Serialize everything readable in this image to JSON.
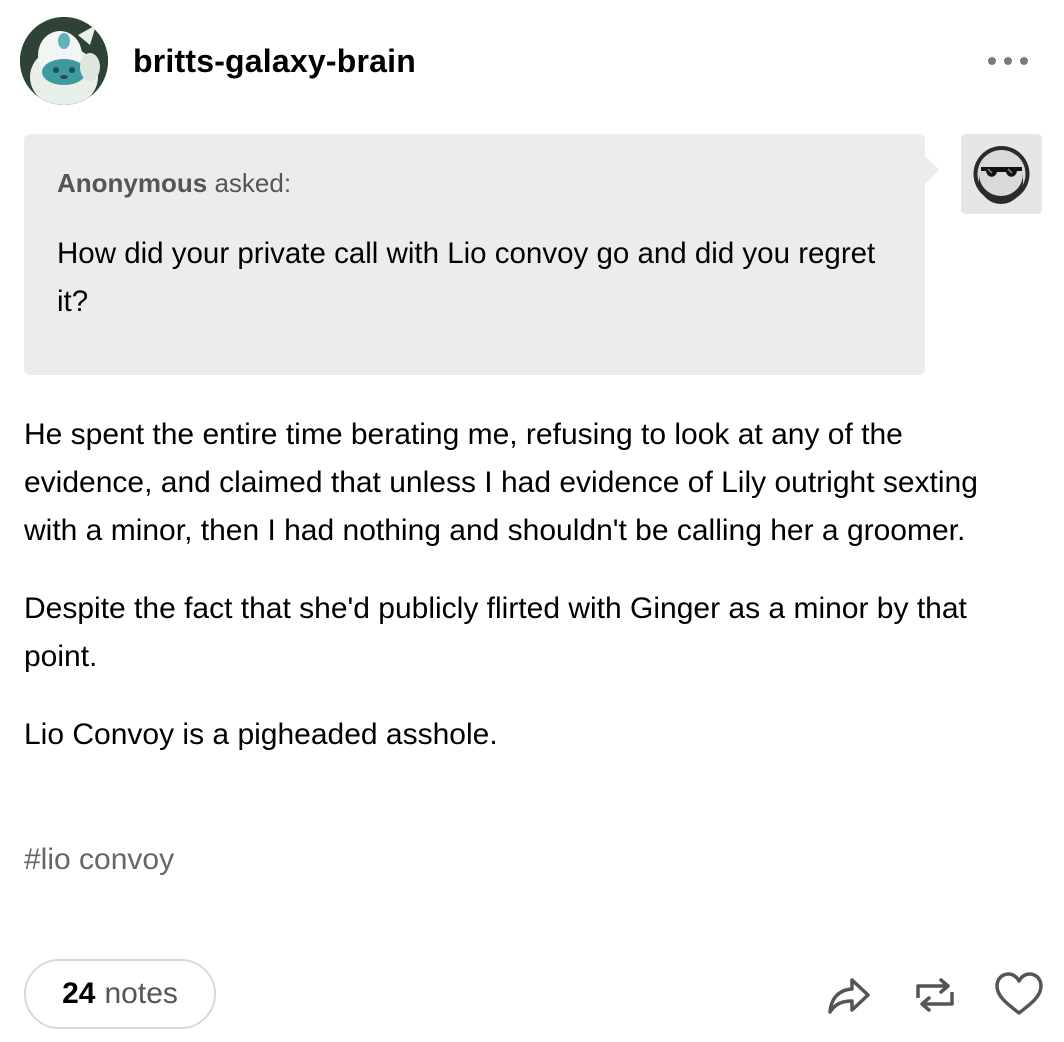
{
  "post": {
    "blog_name": "britts-galaxy-brain",
    "ask": {
      "asker": "Anonymous",
      "asked_label": "asked:",
      "question": "How did your private call with Lio convoy go and did you regret it?"
    },
    "paragraphs": [
      "He spent the entire time berating me, refusing to look at any of the evidence, and claimed that unless I had evidence of Lily outright sexting with a minor, then I had nothing and shouldn't be calling her a groomer.",
      "Despite the fact that she'd publicly flirted with Ginger as a minor by that point.",
      "Lio Convoy is a pigheaded asshole."
    ],
    "tags": [
      "#lio convoy"
    ],
    "notes": {
      "count": "24",
      "label": "notes"
    }
  },
  "icons": {
    "more": "more-horizontal-icon",
    "share": "share-icon",
    "reblog": "reblog-icon",
    "like": "heart-icon"
  },
  "colors": {
    "bubble_bg": "#ececec",
    "muted_text": "#555555",
    "tag_text": "#666666",
    "icon_gray": "#777a80"
  }
}
